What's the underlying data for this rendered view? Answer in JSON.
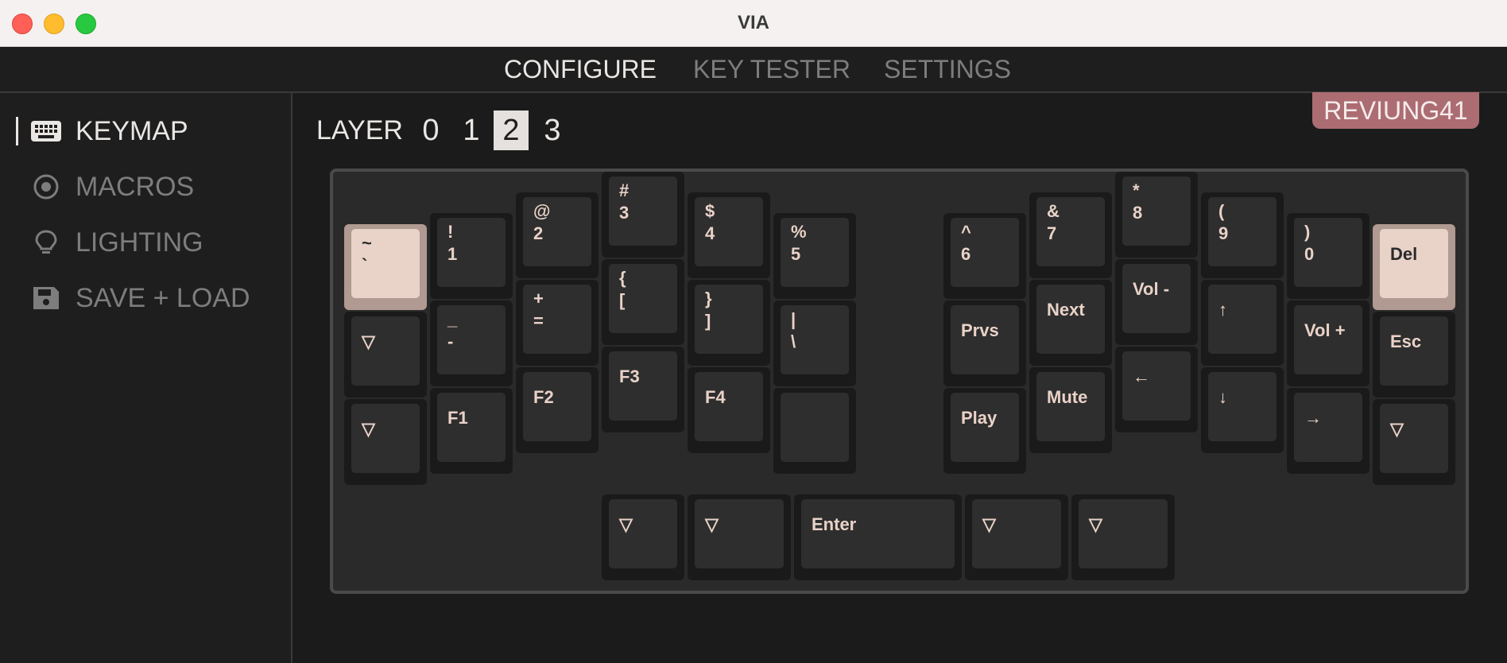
{
  "window": {
    "title": "VIA"
  },
  "nav": {
    "tabs": [
      {
        "label": "CONFIGURE"
      },
      {
        "label": "KEY TESTER"
      },
      {
        "label": "SETTINGS"
      }
    ]
  },
  "sidebar": {
    "items": [
      {
        "label": "KEYMAP",
        "icon": "keyboard-icon"
      },
      {
        "label": "MACROS",
        "icon": "target-icon"
      },
      {
        "label": "LIGHTING",
        "icon": "lightbulb-icon"
      },
      {
        "label": "SAVE + LOAD",
        "icon": "floppy-disk-icon"
      }
    ]
  },
  "layer": {
    "label": "LAYER",
    "options": [
      "0",
      "1",
      "2",
      "3"
    ],
    "selected": "2"
  },
  "device": {
    "name": "REVIUNG41"
  },
  "colors": {
    "accent": "#e9d2c8",
    "badge": "#ac6d72"
  },
  "keys": [
    {
      "top": "~",
      "bottom": "`"
    },
    {
      "top": "!",
      "bottom": "1"
    },
    {
      "top": "@",
      "bottom": "2"
    },
    {
      "top": "#",
      "bottom": "3"
    },
    {
      "top": "$",
      "bottom": "4"
    },
    {
      "top": "%",
      "bottom": "5"
    },
    {
      "top": "^",
      "bottom": "6"
    },
    {
      "top": "&",
      "bottom": "7"
    },
    {
      "top": "*",
      "bottom": "8"
    },
    {
      "top": "(",
      "bottom": "9"
    },
    {
      "top": ")",
      "bottom": "0"
    },
    {
      "top": "Del",
      "bottom": ""
    },
    {
      "top": "▽",
      "bottom": ""
    },
    {
      "top": "_",
      "bottom": "-"
    },
    {
      "top": "+",
      "bottom": "="
    },
    {
      "top": "{",
      "bottom": "["
    },
    {
      "top": "}",
      "bottom": "]"
    },
    {
      "top": "|",
      "bottom": "\\"
    },
    {
      "top": "Prvs",
      "bottom": ""
    },
    {
      "top": "Next",
      "bottom": ""
    },
    {
      "top": "Vol -",
      "bottom": ""
    },
    {
      "top": "↑",
      "bottom": ""
    },
    {
      "top": "Vol +",
      "bottom": ""
    },
    {
      "top": "Esc",
      "bottom": ""
    },
    {
      "top": "▽",
      "bottom": ""
    },
    {
      "top": "F1",
      "bottom": ""
    },
    {
      "top": "F2",
      "bottom": ""
    },
    {
      "top": "F3",
      "bottom": ""
    },
    {
      "top": "F4",
      "bottom": ""
    },
    {
      "top": "",
      "bottom": ""
    },
    {
      "top": "Play",
      "bottom": ""
    },
    {
      "top": "Mute",
      "bottom": ""
    },
    {
      "top": "←",
      "bottom": ""
    },
    {
      "top": "↓",
      "bottom": ""
    },
    {
      "top": "→",
      "bottom": ""
    },
    {
      "top": "▽",
      "bottom": ""
    },
    {
      "top": "▽",
      "bottom": ""
    },
    {
      "top": "▽",
      "bottom": ""
    },
    {
      "top": "Enter",
      "bottom": ""
    },
    {
      "top": "▽",
      "bottom": ""
    },
    {
      "top": "▽",
      "bottom": ""
    }
  ]
}
